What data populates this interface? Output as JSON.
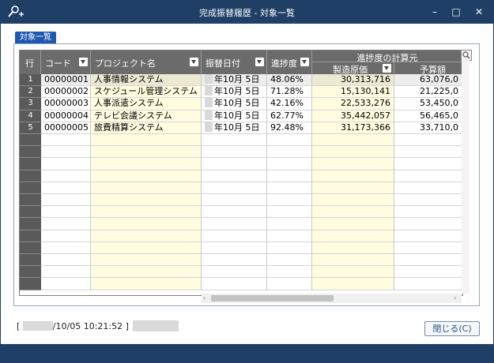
{
  "window": {
    "title": "完成振替履歴 - 対象一覧",
    "min_glyph": "–",
    "max_glyph": "□",
    "close_glyph": "✕"
  },
  "tab": {
    "label": "対象一覧"
  },
  "grid": {
    "headers": {
      "row": "行",
      "code": "コード",
      "project": "プロジェクト名",
      "date": "振替日付",
      "progress": "進捗度",
      "calc_group": "進捗度の計算元",
      "mfg_cost": "製造原価",
      "budget": "予算額"
    },
    "rows": [
      {
        "no": "1",
        "code": "00000001",
        "project": "人事情報システム",
        "date": "年10月  5日",
        "progress": "48.06%",
        "mfg_cost": "30,313,716",
        "budget": "63,076,0"
      },
      {
        "no": "2",
        "code": "00000002",
        "project": "スケジュール管理システム",
        "date": "年10月  5日",
        "progress": "71.28%",
        "mfg_cost": "15,130,141",
        "budget": "21,225,0"
      },
      {
        "no": "3",
        "code": "00000003",
        "project": "人事派遣システム",
        "date": "年10月  5日",
        "progress": "42.16%",
        "mfg_cost": "22,533,276",
        "budget": "53,450,0"
      },
      {
        "no": "4",
        "code": "00000004",
        "project": "テレビ会議システム",
        "date": "年10月  5日",
        "progress": "62.77%",
        "mfg_cost": "35,442,057",
        "budget": "56,465,0"
      },
      {
        "no": "5",
        "code": "00000005",
        "project": "旅費精算システム",
        "date": "年10月  5日",
        "progress": "92.48%",
        "mfg_cost": "31,173,366",
        "budget": "33,710,0"
      }
    ]
  },
  "status": {
    "timestamp": "/10/05 10:21:52 ]",
    "open_bracket": "["
  },
  "buttons": {
    "close": "閉じる(C)"
  },
  "colors": {
    "chrome": "#1f3f66",
    "header": "#6b6b6b",
    "editable": "#fffce0",
    "tab": "#1f58b0"
  }
}
